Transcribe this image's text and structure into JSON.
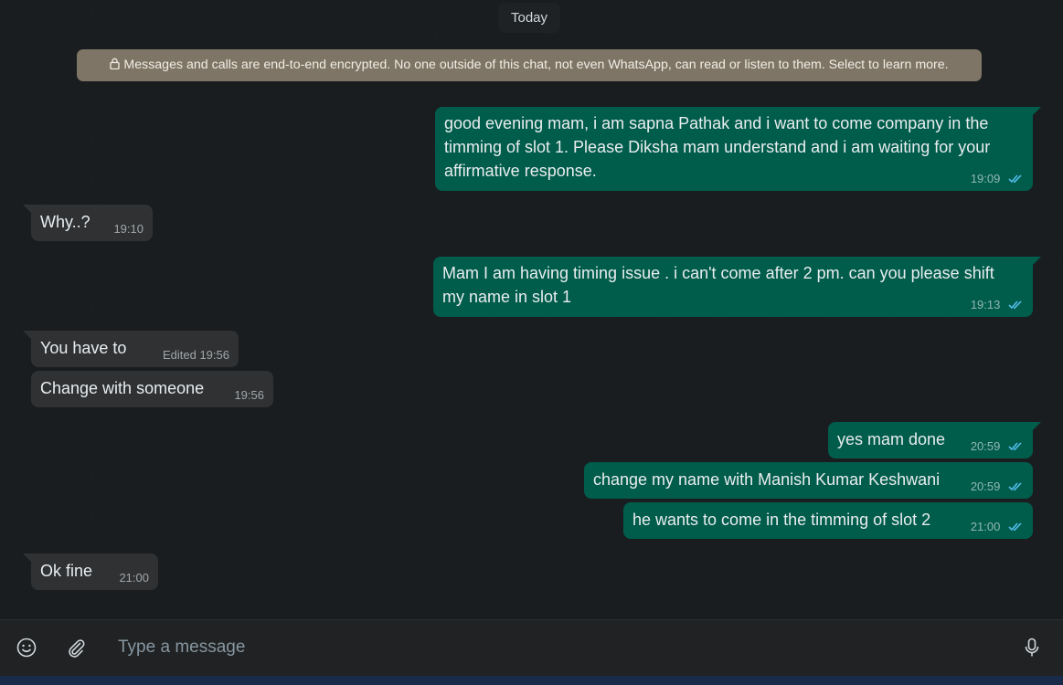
{
  "chat": {
    "date_label": "Today",
    "encryption_notice": "Messages and calls are end-to-end encrypted. No one outside of this chat, not even WhatsApp, can read or listen to them. Select to learn more.",
    "messages": [
      {
        "direction": "outgoing",
        "lines": [
          "good evening mam, i am sapna Pathak and i want to come company in the",
          "timming of slot 1. Please Diksha mam understand and i am waiting for your",
          "affirmative response."
        ],
        "time": "19:09",
        "status": "read"
      },
      {
        "direction": "incoming",
        "lines": [
          "Why..?"
        ],
        "time": "19:10"
      },
      {
        "direction": "outgoing",
        "lines": [
          "Mam I am having timing issue . i can't come after 2 pm. can you please shift",
          "my name in slot 1"
        ],
        "time": "19:13",
        "status": "read"
      },
      {
        "direction": "incoming",
        "lines": [
          "You have to"
        ],
        "time": "Edited 19:56"
      },
      {
        "direction": "incoming",
        "lines": [
          "Change with someone"
        ],
        "time": "19:56"
      },
      {
        "direction": "outgoing",
        "lines": [
          "yes mam done"
        ],
        "time": "20:59",
        "status": "read"
      },
      {
        "direction": "outgoing",
        "lines": [
          "change my name with Manish Kumar Keshwani"
        ],
        "time": "20:59",
        "status": "read"
      },
      {
        "direction": "outgoing",
        "lines": [
          "he wants to come in the timming of slot 2"
        ],
        "time": "21:00",
        "status": "read"
      },
      {
        "direction": "incoming",
        "lines": [
          "Ok fine"
        ],
        "time": "21:00"
      }
    ]
  },
  "composer": {
    "placeholder": "Type a message",
    "icons": [
      "emoji-icon",
      "attach-icon",
      "microphone-icon"
    ]
  },
  "colors": {
    "outgoing_bubble": "#005c4b",
    "incoming_bubble": "#2f3133",
    "encryption_banner": "#7f7566",
    "read_ticks": "#53bdeb"
  }
}
